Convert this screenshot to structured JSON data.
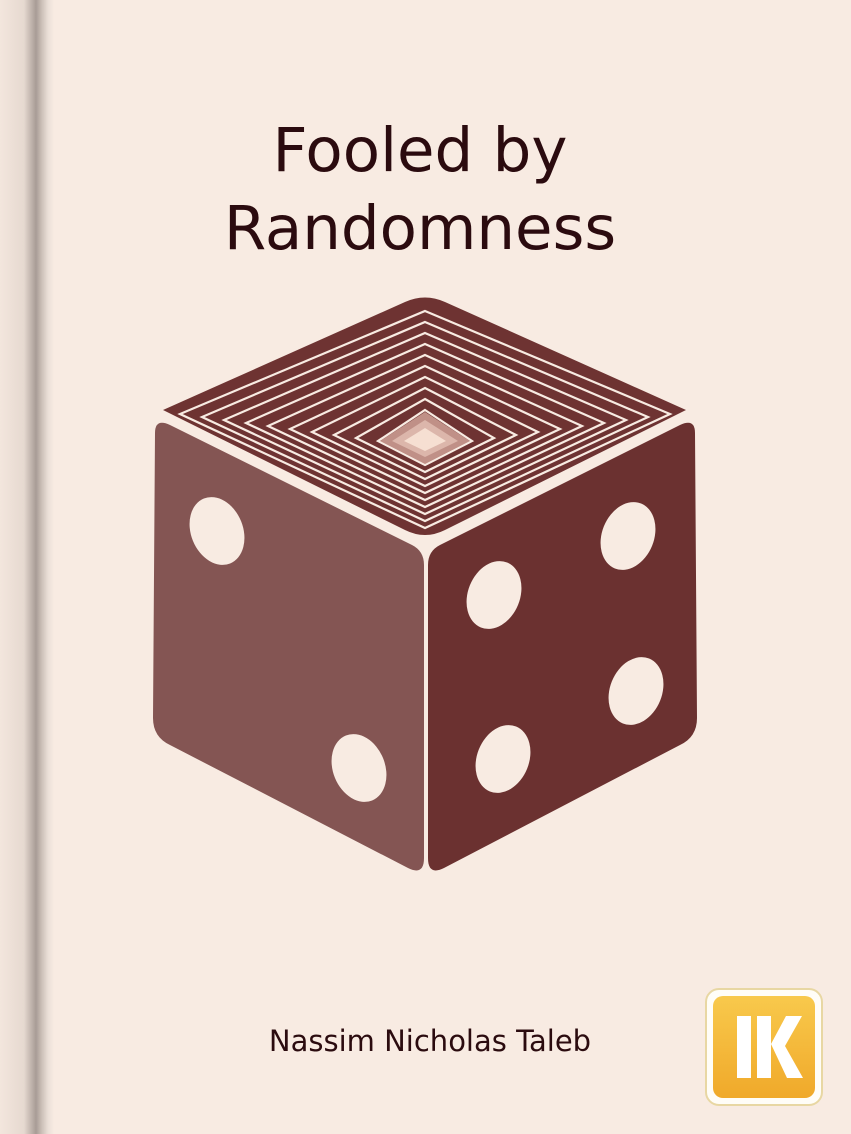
{
  "cover": {
    "title_line1": "Fooled by",
    "title_line2": "Randomness",
    "author": "Nassim Nicholas Taleb",
    "logo_text": "IK"
  },
  "colors": {
    "background": "#f8ebe2",
    "text": "#2b0b0f",
    "dice_left_face": "#845553",
    "dice_right_face": "#6b3130",
    "dice_top_face": "#6e3332",
    "pips": "#f8ebe2",
    "logo": "#f5b83a"
  },
  "icons": {
    "dice": "dice-icon",
    "logo": "ik-logo"
  }
}
